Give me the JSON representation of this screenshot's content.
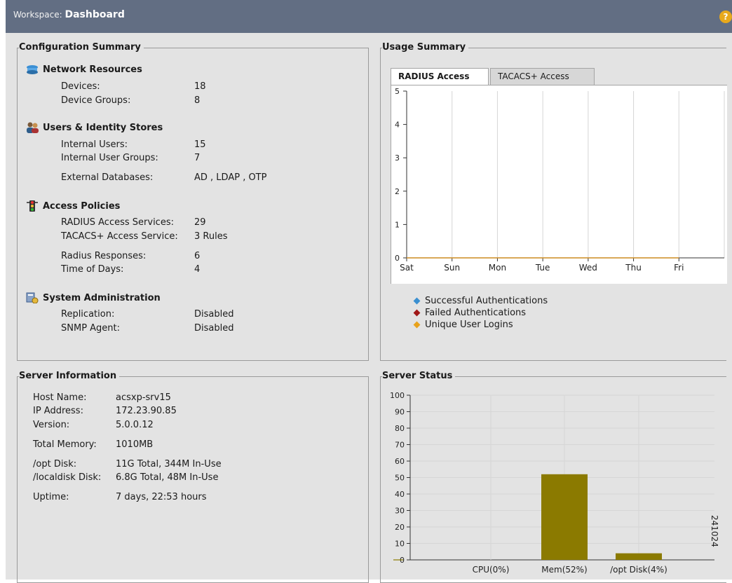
{
  "workspace": {
    "prefix": "Workspace:",
    "name": "Dashboard"
  },
  "help": {
    "glyph": "?"
  },
  "config_summary": {
    "title": "Configuration Summary",
    "network_resources": {
      "title": "Network Resources",
      "rows": [
        {
          "label": "Devices:",
          "value": "18"
        },
        {
          "label": "Device Groups:",
          "value": "8"
        }
      ]
    },
    "users_identity": {
      "title": "Users & Identity Stores",
      "rows": [
        {
          "label": "Internal Users:",
          "value": "15"
        },
        {
          "label": "Internal User Groups:",
          "value": "7"
        },
        {
          "label": "External Databases:",
          "value": "AD , LDAP , OTP"
        }
      ]
    },
    "access_policies": {
      "title": "Access Policies",
      "rows": [
        {
          "label": "RADIUS Access Services:",
          "value": "29"
        },
        {
          "label": "TACACS+ Access Service:",
          "value": "3 Rules"
        },
        {
          "label": "Radius Responses:",
          "value": "6"
        },
        {
          "label": "Time of Days:",
          "value": "4"
        }
      ]
    },
    "system_admin": {
      "title": "System Administration",
      "rows": [
        {
          "label": "Replication:",
          "value": "Disabled"
        },
        {
          "label": "SNMP Agent:",
          "value": "Disabled"
        }
      ]
    }
  },
  "usage_summary": {
    "title": "Usage Summary",
    "tabs": [
      "RADIUS Access",
      "TACACS+ Access"
    ],
    "legend": [
      {
        "label": "Successful Authentications",
        "color": "#3a8fd0"
      },
      {
        "label": "Failed Authentications",
        "color": "#a01818"
      },
      {
        "label": "Unique User Logins",
        "color": "#e8a21c"
      }
    ]
  },
  "server_info": {
    "title": "Server Information",
    "rows": [
      {
        "label": "Host Name:",
        "value": "acsxp-srv15"
      },
      {
        "label": "IP Address:",
        "value": "172.23.90.85"
      },
      {
        "label": "Version:",
        "value": "5.0.0.12"
      },
      {
        "label": "Total Memory:",
        "value": "1010MB"
      },
      {
        "label": "/opt Disk:",
        "value": "11G  Total,  344M  In-Use"
      },
      {
        "label": "/localdisk Disk:",
        "value": "6.8G  Total,  48M  In-Use"
      },
      {
        "label": "Uptime:",
        "value": "7 days, 22:53 hours"
      }
    ]
  },
  "server_status": {
    "title": "Server Status"
  },
  "side_label": "241024",
  "chart_data": [
    {
      "type": "line",
      "categories": [
        "Sat",
        "Sun",
        "Mon",
        "Tue",
        "Wed",
        "Thu",
        "Fri"
      ],
      "series": [
        {
          "name": "Successful Authentications",
          "values": [
            0,
            0,
            0,
            0,
            0,
            0,
            0
          ],
          "color": "#3a8fd0"
        },
        {
          "name": "Failed Authentications",
          "values": [
            0,
            0,
            0,
            0,
            0,
            0,
            0
          ],
          "color": "#a01818"
        },
        {
          "name": "Unique User Logins",
          "values": [
            0,
            0,
            0,
            0,
            0,
            0,
            0
          ],
          "color": "#e8a21c"
        }
      ],
      "yticks": [
        "0",
        "1",
        "2",
        "3",
        "4",
        "5"
      ],
      "ylim": [
        0,
        5
      ],
      "grid": true,
      "legend_position": "bottom"
    },
    {
      "type": "bar",
      "categories": [
        "CPU(0%)",
        "Mem(52%)",
        "/opt Disk(4%)"
      ],
      "values": [
        0,
        52,
        4
      ],
      "bar_color": "#8b7a00",
      "yticks": [
        "0",
        "10",
        "20",
        "30",
        "40",
        "50",
        "60",
        "70",
        "80",
        "90",
        "100"
      ],
      "ylim": [
        0,
        100
      ],
      "grid": true
    }
  ]
}
